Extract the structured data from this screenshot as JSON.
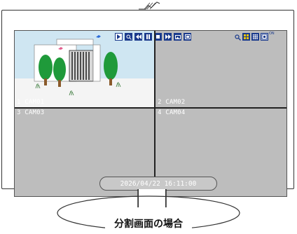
{
  "caption": "分割画面の場合",
  "cameras": [
    {
      "label": "1 CAM01"
    },
    {
      "label": "2 CAM02"
    },
    {
      "label": "3 CAM03"
    },
    {
      "label": "4 CAM04"
    }
  ],
  "timestamp": "2026/04/22 16:11:00",
  "toolbar": {
    "playback_icons": [
      "play-icon",
      "zoom-search-icon",
      "rewind-icon",
      "pause-icon",
      "stop-icon",
      "fast-forward-icon",
      "snapshot-icon",
      "clip-icon"
    ],
    "layout_icons": [
      "zoom-icon",
      "grid-4-icon",
      "grid-9-icon",
      "layout-single-icon"
    ],
    "layout_badge": "ON"
  },
  "colors": {
    "screen_bg": "#bdbdbd",
    "toolbar_blue": "#1a3a8c",
    "toolbar_yellow": "#f2c500",
    "tree_green": "#1f9a3a",
    "sky": "#cfe6f2"
  }
}
